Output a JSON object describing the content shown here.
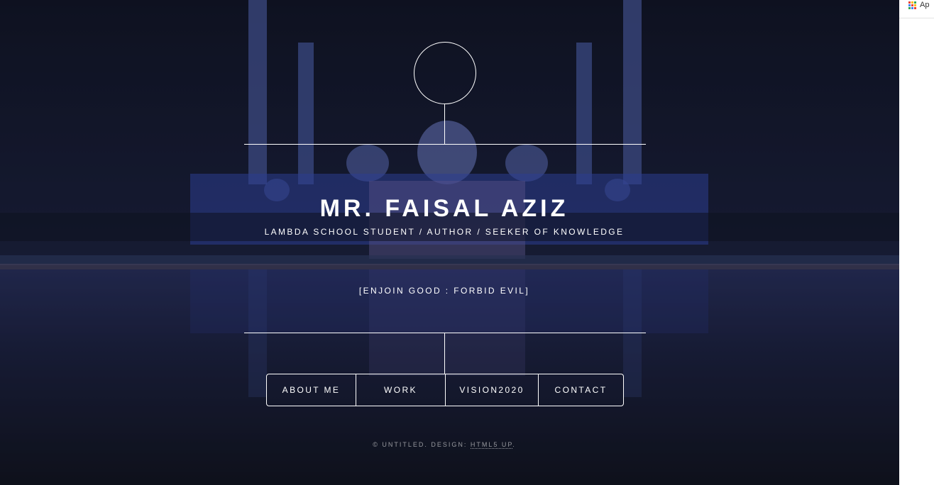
{
  "header": {
    "title": "MR. FAISAL AZIZ",
    "subtitle": "LAMBDA SCHOOL STUDENT / AUTHOR / SEEKER OF KNOWLEDGE",
    "motto": "[ENJOIN GOOD : FORBID EVIL]"
  },
  "nav": {
    "items": [
      {
        "label": "ABOUT ME"
      },
      {
        "label": "WORK"
      },
      {
        "label": "VISION2020"
      },
      {
        "label": "CONTACT"
      }
    ]
  },
  "footer": {
    "prefix": "© UNTITLED. DESIGN: ",
    "link": "HTML5 UP",
    "suffix": "."
  },
  "browser": {
    "apps_label": "Ap",
    "apps_icon": "apps-grid-icon"
  },
  "colors": {
    "text": "#ffffff",
    "background_dark": "#15182a",
    "accent_blue": "#3a5bd6"
  }
}
